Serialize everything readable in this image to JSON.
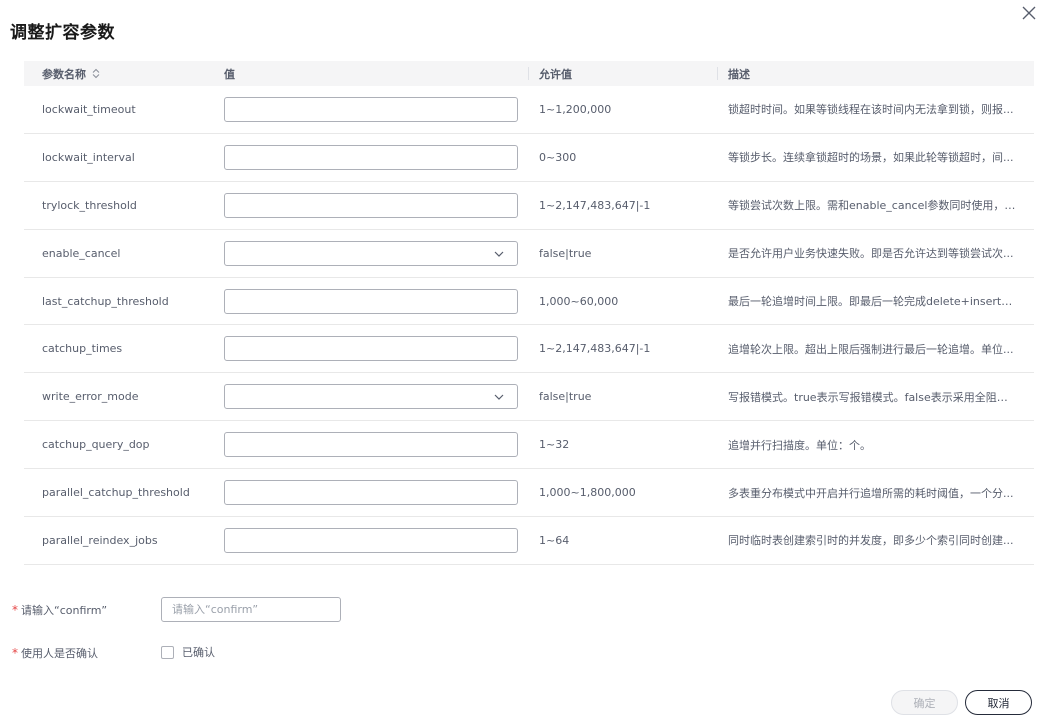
{
  "dialog": {
    "title": "调整扩容参数"
  },
  "table": {
    "headers": {
      "name": "参数名称",
      "value": "值",
      "allowed": "允许值",
      "desc": "描述"
    },
    "rows": [
      {
        "name": "lockwait_timeout",
        "type": "input",
        "value": "",
        "allowed": "1~1,200,000",
        "desc": "锁超时时间。如果等锁线程在该时间内无法拿到锁，则报..."
      },
      {
        "name": "lockwait_interval",
        "type": "input",
        "value": "",
        "allowed": "0~300",
        "desc": "等锁步长。连续拿锁超时的场景，如果此轮等锁超时，间..."
      },
      {
        "name": "trylock_threshold",
        "type": "input",
        "value": "",
        "allowed": "1~2,147,483,647|-1",
        "desc": "等锁尝试次数上限。需和enable_cancel参数同时使用，如..."
      },
      {
        "name": "enable_cancel",
        "type": "select",
        "value": "",
        "allowed": "false|true",
        "desc": "是否允许用户业务快速失败。即是否允许达到等锁尝试次..."
      },
      {
        "name": "last_catchup_threshold",
        "type": "input",
        "value": "",
        "allowed": "1,000~60,000",
        "desc": "最后一轮追增时间上限。即最后一轮完成delete+insert追..."
      },
      {
        "name": "catchup_times",
        "type": "input",
        "value": "",
        "allowed": "1~2,147,483,647|-1",
        "desc": "追增轮次上限。超出上限后强制进行最后一轮追增。单位..."
      },
      {
        "name": "write_error_mode",
        "type": "select",
        "value": "",
        "allowed": "false|true",
        "desc": "写报错模式。true表示写报错模式。false表示采用全阻塞..."
      },
      {
        "name": "catchup_query_dop",
        "type": "input",
        "value": "",
        "allowed": "1~32",
        "desc": "追增并行扫描度。单位：个。"
      },
      {
        "name": "parallel_catchup_threshold",
        "type": "input",
        "value": "",
        "allowed": "1,000~1,800,000",
        "desc": "多表重分布模式中开启并行追增所需的耗时阈值，一个分..."
      },
      {
        "name": "parallel_reindex_jobs",
        "type": "input",
        "value": "",
        "allowed": "1~64",
        "desc": "同时临时表创建索引时的并发度，即多少个索引同时创建..."
      }
    ]
  },
  "form": {
    "required_mark": "*",
    "confirm_label": "请输入“confirm”",
    "confirm_placeholder": "请输入“confirm”",
    "confirm_value": "",
    "user_confirm_label": "使用人是否确认",
    "checkbox_label": "已确认"
  },
  "footer": {
    "ok_label": "确定",
    "cancel_label": "取消"
  },
  "colors": {
    "required": "#e54545",
    "header_bg": "#f5f5f6",
    "border": "#adb0b8"
  }
}
